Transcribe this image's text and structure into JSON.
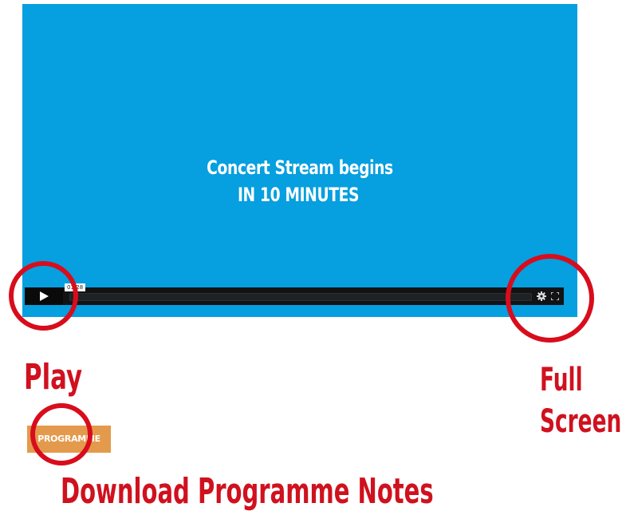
{
  "video": {
    "background_color": "#069fe0",
    "message_line1": "Concert Stream begins",
    "message_line2": "IN 10 MINUTES"
  },
  "player_controls": {
    "time_display": "01:28",
    "play_icon": "play-icon",
    "settings_icon": "gear-icon",
    "fullscreen_icon": "fullscreen-icon"
  },
  "programme_button": {
    "label": "PROGRAMME",
    "color": "#e49a4c"
  },
  "annotations": {
    "color": "#d0111e",
    "play_label": "Play",
    "full_screen_line1": "Full",
    "full_screen_line2": "Screen",
    "download_label": "Download Programme Notes"
  }
}
